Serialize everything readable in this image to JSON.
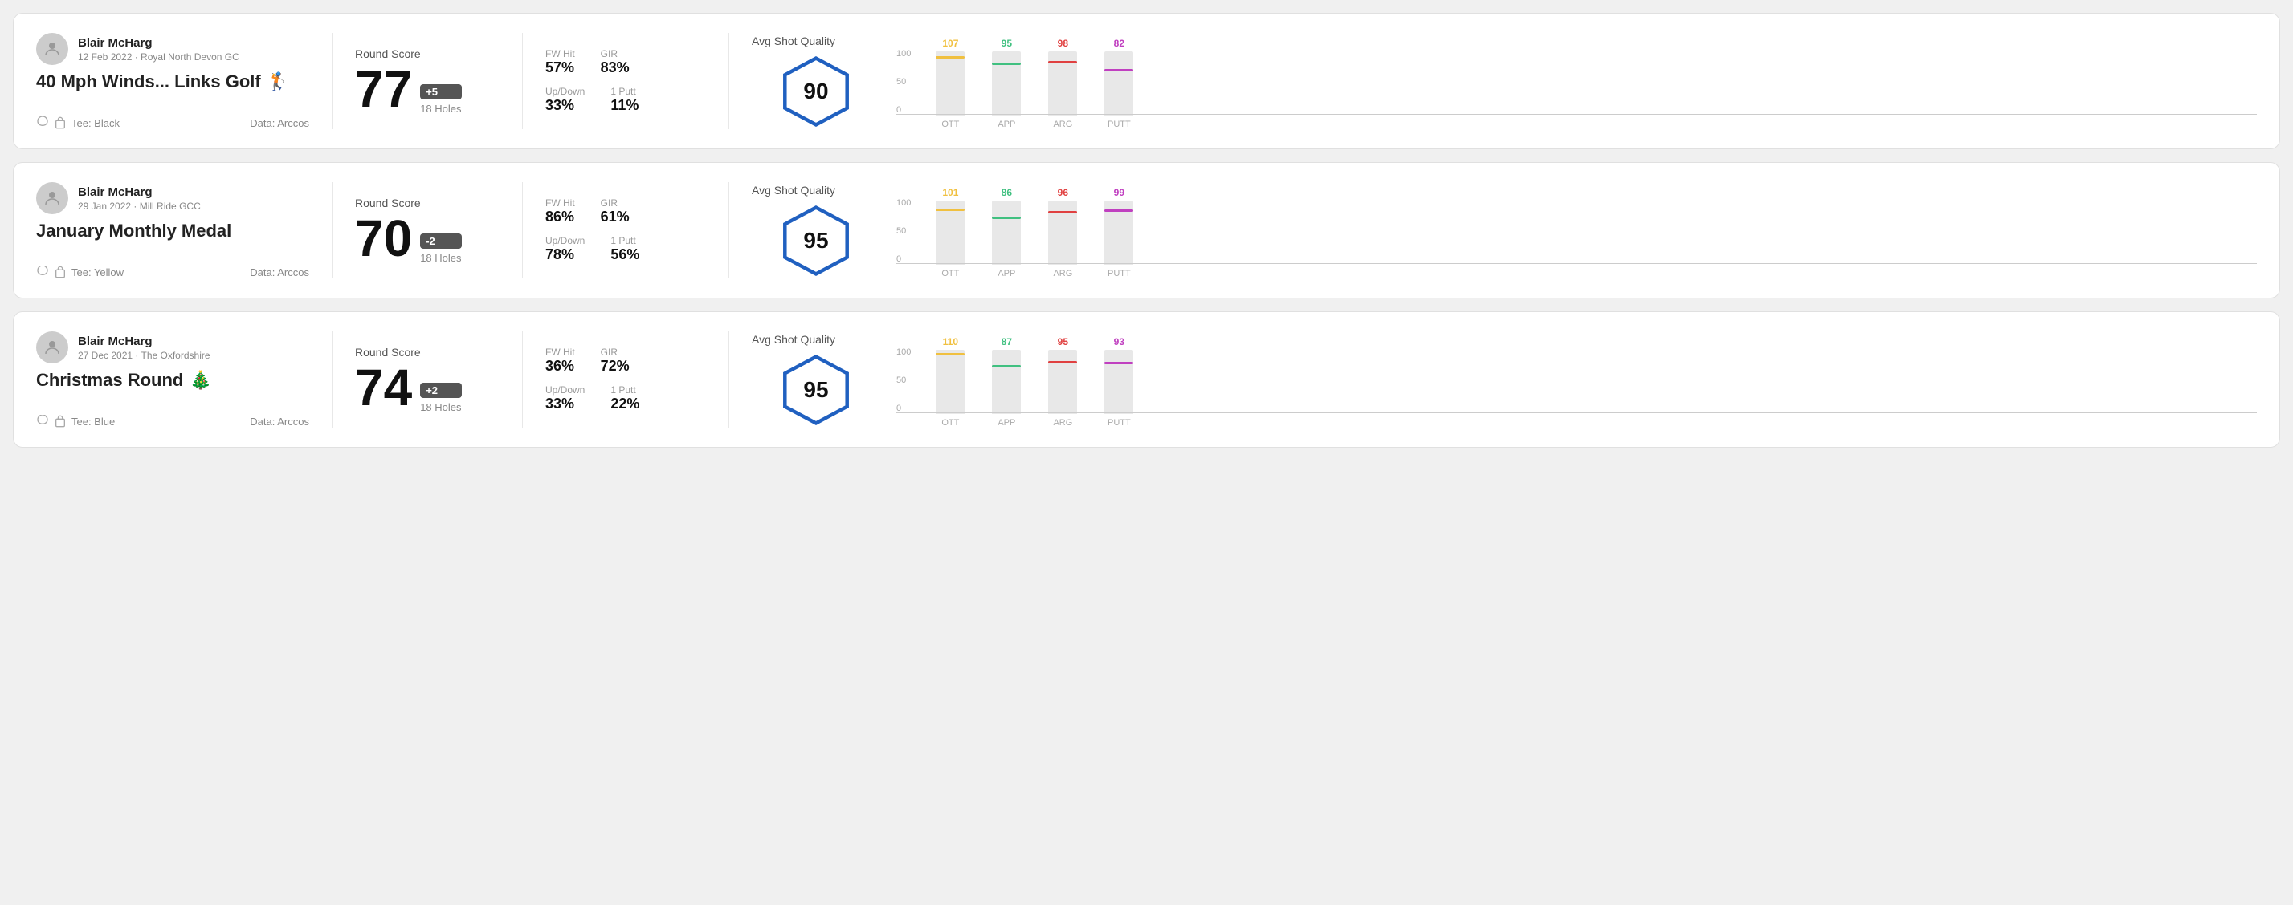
{
  "rounds": [
    {
      "id": "round1",
      "player_name": "Blair McHarg",
      "date": "12 Feb 2022 · Royal North Devon GC",
      "title": "40 Mph Winds... Links Golf",
      "title_emoji": "🏌️",
      "tee": "Tee: Black",
      "data_source": "Data: Arccos",
      "score": "77",
      "score_diff": "+5",
      "holes": "18 Holes",
      "fw_hit": "57%",
      "gir": "83%",
      "up_down": "33%",
      "one_putt": "11%",
      "avg_quality": "90",
      "quality_label": "Avg Shot Quality",
      "chart": {
        "bars": [
          {
            "label": "OTT",
            "value": 107,
            "color": "#f0c040"
          },
          {
            "label": "APP",
            "value": 95,
            "color": "#40c080"
          },
          {
            "label": "ARG",
            "value": 98,
            "color": "#e04040"
          },
          {
            "label": "PUTT",
            "value": 82,
            "color": "#c040c0"
          }
        ]
      }
    },
    {
      "id": "round2",
      "player_name": "Blair McHarg",
      "date": "29 Jan 2022 · Mill Ride GCC",
      "title": "January Monthly Medal",
      "title_emoji": "",
      "tee": "Tee: Yellow",
      "data_source": "Data: Arccos",
      "score": "70",
      "score_diff": "-2",
      "holes": "18 Holes",
      "fw_hit": "86%",
      "gir": "61%",
      "up_down": "78%",
      "one_putt": "56%",
      "avg_quality": "95",
      "quality_label": "Avg Shot Quality",
      "chart": {
        "bars": [
          {
            "label": "OTT",
            "value": 101,
            "color": "#f0c040"
          },
          {
            "label": "APP",
            "value": 86,
            "color": "#40c080"
          },
          {
            "label": "ARG",
            "value": 96,
            "color": "#e04040"
          },
          {
            "label": "PUTT",
            "value": 99,
            "color": "#c040c0"
          }
        ]
      }
    },
    {
      "id": "round3",
      "player_name": "Blair McHarg",
      "date": "27 Dec 2021 · The Oxfordshire",
      "title": "Christmas Round",
      "title_emoji": "🎄",
      "tee": "Tee: Blue",
      "data_source": "Data: Arccos",
      "score": "74",
      "score_diff": "+2",
      "holes": "18 Holes",
      "fw_hit": "36%",
      "gir": "72%",
      "up_down": "33%",
      "one_putt": "22%",
      "avg_quality": "95",
      "quality_label": "Avg Shot Quality",
      "chart": {
        "bars": [
          {
            "label": "OTT",
            "value": 110,
            "color": "#f0c040"
          },
          {
            "label": "APP",
            "value": 87,
            "color": "#40c080"
          },
          {
            "label": "ARG",
            "value": 95,
            "color": "#e04040"
          },
          {
            "label": "PUTT",
            "value": 93,
            "color": "#c040c0"
          }
        ]
      }
    }
  ],
  "chart_y_labels": [
    "100",
    "50",
    "0"
  ]
}
